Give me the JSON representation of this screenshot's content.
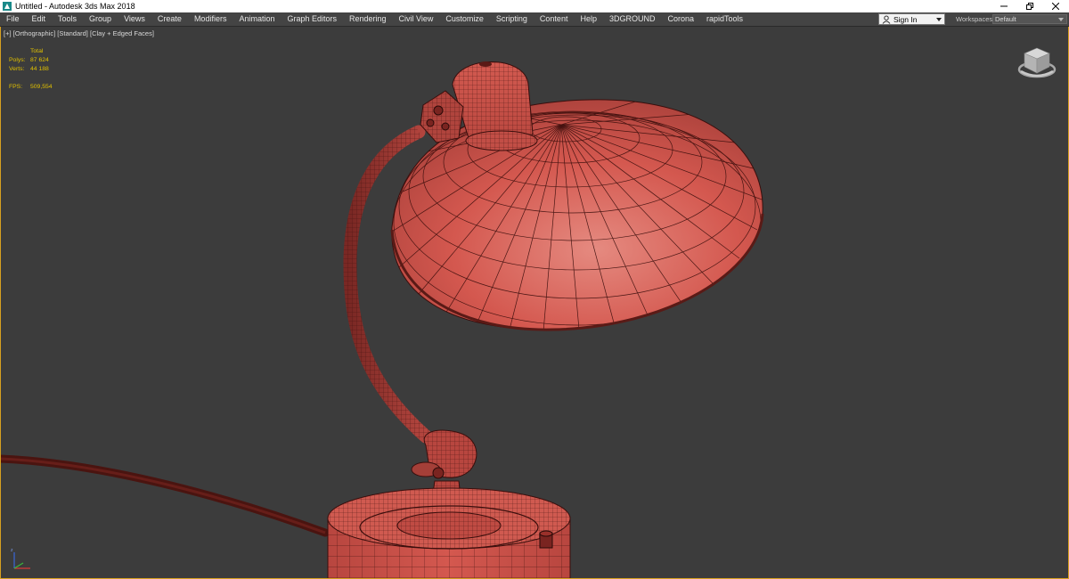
{
  "window": {
    "title": "Untitled - Autodesk 3ds Max 2018",
    "app_icon": "3ds-max-icon",
    "controls": [
      "minimize-icon",
      "restore-icon",
      "close-icon"
    ]
  },
  "menu": {
    "items": [
      {
        "label": "File"
      },
      {
        "label": "Edit"
      },
      {
        "label": "Tools"
      },
      {
        "label": "Group"
      },
      {
        "label": "Views"
      },
      {
        "label": "Create"
      },
      {
        "label": "Modifiers"
      },
      {
        "label": "Animation"
      },
      {
        "label": "Graph Editors"
      },
      {
        "label": "Rendering"
      },
      {
        "label": "Civil View"
      },
      {
        "label": "Customize"
      },
      {
        "label": "Scripting"
      },
      {
        "label": "Content"
      },
      {
        "label": "Help"
      },
      {
        "label": "3DGROUND"
      },
      {
        "label": "Corona"
      },
      {
        "label": "rapidTools"
      }
    ],
    "sign_in": "Sign In",
    "workspaces_label": "Workspaces:",
    "workspaces_value": "Default"
  },
  "viewport": {
    "labels": [
      "[+]",
      "[Orthographic]",
      "[Standard]",
      "[Clay + Edged Faces]"
    ],
    "stats": {
      "header": "Total",
      "polys_label": "Polys:",
      "polys_value": "87 624",
      "verts_label": "Verts:",
      "verts_value": "44 188",
      "fps_label": "FPS:",
      "fps_value": "509,554"
    },
    "colors": {
      "background": "#3c3c3c",
      "clay": "#d4584f",
      "wire": "#3a0e0c",
      "active_border": "#d6a020",
      "stats_text": "#e0c000"
    }
  }
}
